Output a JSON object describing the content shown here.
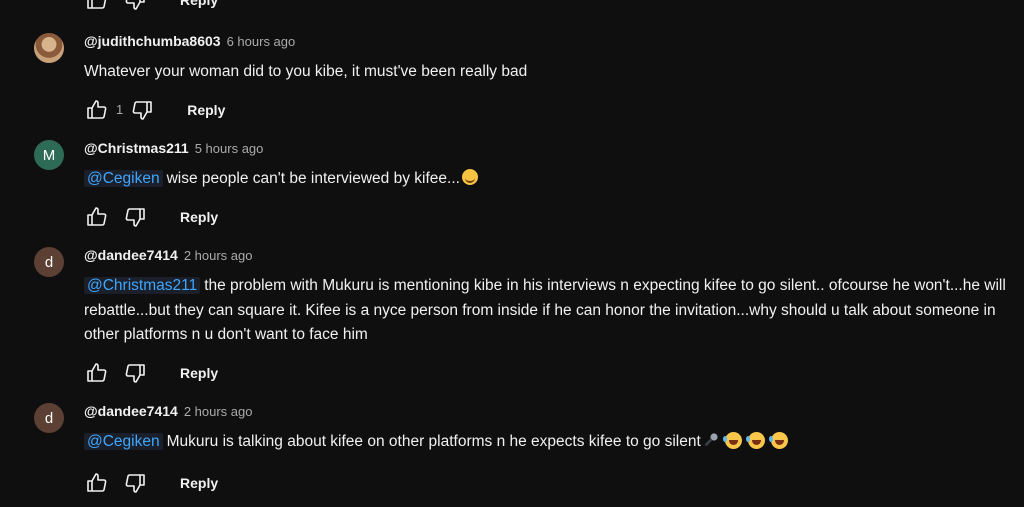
{
  "top_actions": {
    "reply_label": "Reply"
  },
  "comments": [
    {
      "author": "@judithchumba8603",
      "time": "6 hours ago",
      "avatar_letter": "",
      "mention": "",
      "text": "Whatever your woman did to you kibe, it must've been really bad",
      "like_count": "1",
      "reply_label": "Reply"
    },
    {
      "author": "@Christmas211",
      "time": "5 hours ago",
      "avatar_letter": "M",
      "mention": "@Cegiken",
      "text": "wise people can't  be interviewed by kifee...",
      "like_count": "",
      "reply_label": "Reply"
    },
    {
      "author": "@dandee7414",
      "time": "2 hours ago",
      "avatar_letter": "d",
      "mention": "@Christmas211",
      "text": "the problem with Mukuru is mentioning kibe in his interviews n expecting kifee to go silent.. ofcourse he won't...he will rebattle...but they can square it. Kifee is a nyce person from inside if he can honor the invitation...why should u talk about someone in other platforms n u don't want to face him",
      "like_count": "",
      "reply_label": "Reply"
    },
    {
      "author": "@dandee7414",
      "time": "2 hours ago",
      "avatar_letter": "d",
      "mention": "@Cegiken",
      "text": "Mukuru is talking about kifee on other platforms n he expects kifee to go silent",
      "like_count": "",
      "reply_label": "Reply"
    }
  ],
  "icons": {
    "like": "thumbs-up-icon",
    "dislike": "thumbs-down-icon",
    "smile_emoji": "smiling-face-emoji",
    "mic_emoji": "microphone-emoji",
    "laugh_emoji": "rolling-on-floor-laughing-emoji"
  },
  "colors": {
    "background": "#0f0f0f",
    "text": "#f1f1f1",
    "secondary_text": "#aaaaaa",
    "mention": "#3ea6ff",
    "avatar_green": "#2e6b57",
    "avatar_brown": "#5c4033"
  }
}
